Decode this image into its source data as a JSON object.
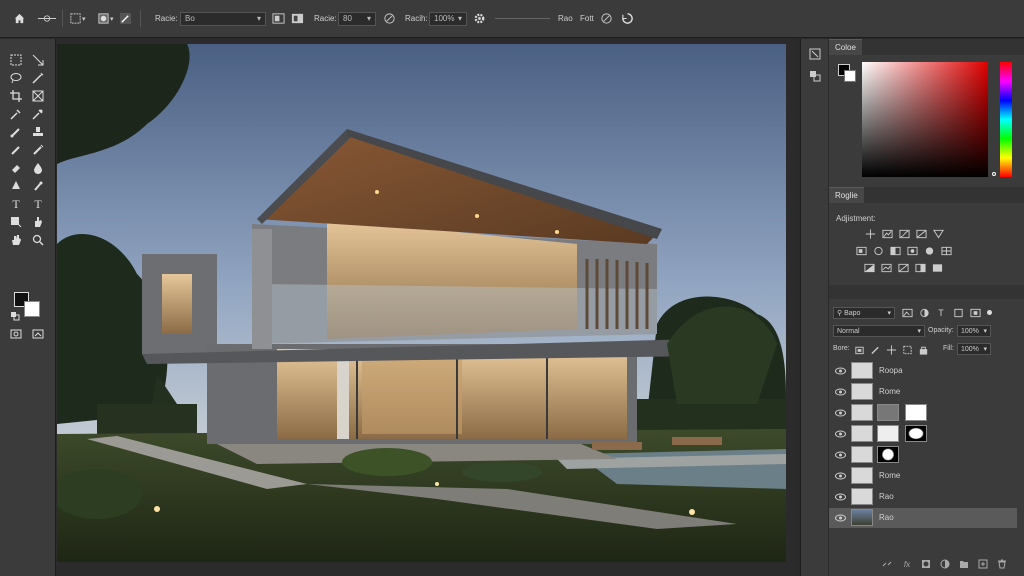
{
  "options_bar": {
    "field1_label": "Racie:",
    "field1_value": "Bo",
    "field2_label": "Racie:",
    "field2_value": "80",
    "field3_label": "Racih:",
    "field3_value": "100%",
    "text1": "Rao",
    "text2": "Fott"
  },
  "panels": {
    "color_tab": "Coloe",
    "adjust_tab": "Roglie",
    "adjustments_title": "Adjistment:",
    "layers_search": "Bapo",
    "blend_mode": "Normal",
    "opacity_label": "Opacity:",
    "opacity_value": "100%",
    "lock_label": "Bore:",
    "fill_label": "Fill:",
    "fill_value": "100%"
  },
  "layers": [
    {
      "name": "Roopa",
      "visible": true,
      "selected": false
    },
    {
      "name": "Rome",
      "visible": true,
      "selected": false
    },
    {
      "name": "",
      "visible": true,
      "selected": false
    },
    {
      "name": "",
      "visible": true,
      "selected": false
    },
    {
      "name": "",
      "visible": true,
      "selected": false
    },
    {
      "name": "Rome",
      "visible": true,
      "selected": false
    },
    {
      "name": "Rao",
      "visible": true,
      "selected": false
    },
    {
      "name": "Rao",
      "visible": true,
      "selected": true
    }
  ],
  "colors": {
    "foreground": "#000000",
    "background": "#ffffff",
    "ui_dark": "#3b3b3b",
    "selected_layer": "#5a5a5a"
  },
  "icons": [
    "home-icon",
    "lasso-icon",
    "crop-icon",
    "eyedropper-icon",
    "brush-icon",
    "stamp-icon",
    "eraser-icon",
    "text-icon",
    "hand-icon",
    "zoom-icon",
    "eye-icon",
    "trash-icon",
    "folder-icon",
    "new-layer-icon",
    "fx-icon",
    "mask-icon",
    "link-icon"
  ]
}
